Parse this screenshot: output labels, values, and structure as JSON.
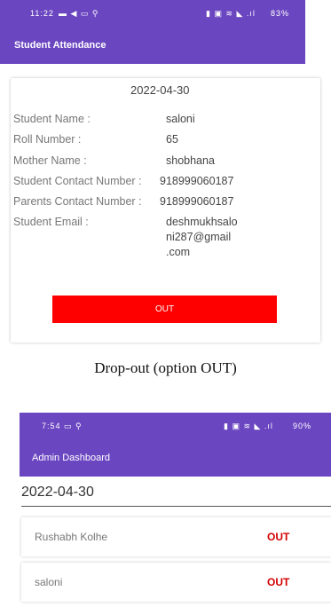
{
  "top": {
    "status_bar": {
      "time": "11:22",
      "left_icons": "▬ ◀ ▭ ⚲",
      "right_icons": "▮ ▣ ≋ ◣ .ıl",
      "battery": "83%"
    },
    "app_title": "Student Attendance",
    "card": {
      "date": "2022-04-30",
      "fields": [
        {
          "label": "Student Name :",
          "value": "saloni"
        },
        {
          "label": "Roll Number :",
          "value": "65"
        },
        {
          "label": "Mother Name :",
          "value": "shobhana"
        },
        {
          "label": "Student Contact Number :",
          "value": "918999060187"
        },
        {
          "label": "Parents Contact Number :",
          "value": "918999060187"
        },
        {
          "label": "Student Email :",
          "value": "deshmukhsalo ni287@gmail .com",
          "value_lines": [
            "deshmukhsalo",
            "ni287@gmail",
            ".com"
          ]
        }
      ],
      "button_label": "OUT",
      "button_color": "#ff0000"
    }
  },
  "caption": "Drop-out (option OUT)",
  "bottom": {
    "status_bar": {
      "time": "7:54",
      "left_icons": "▭ ⚲",
      "right_icons": "▮ ▣ ≋ ◣ .ıl",
      "battery": "90%"
    },
    "app_title": "Admin Dashboard",
    "date": "2022-04-30",
    "items": [
      {
        "name": "Rushabh Kolhe",
        "status": "OUT"
      },
      {
        "name": "saloni",
        "status": "OUT"
      }
    ]
  },
  "colors": {
    "accent": "#6b46c1",
    "out_text": "#d40000"
  }
}
